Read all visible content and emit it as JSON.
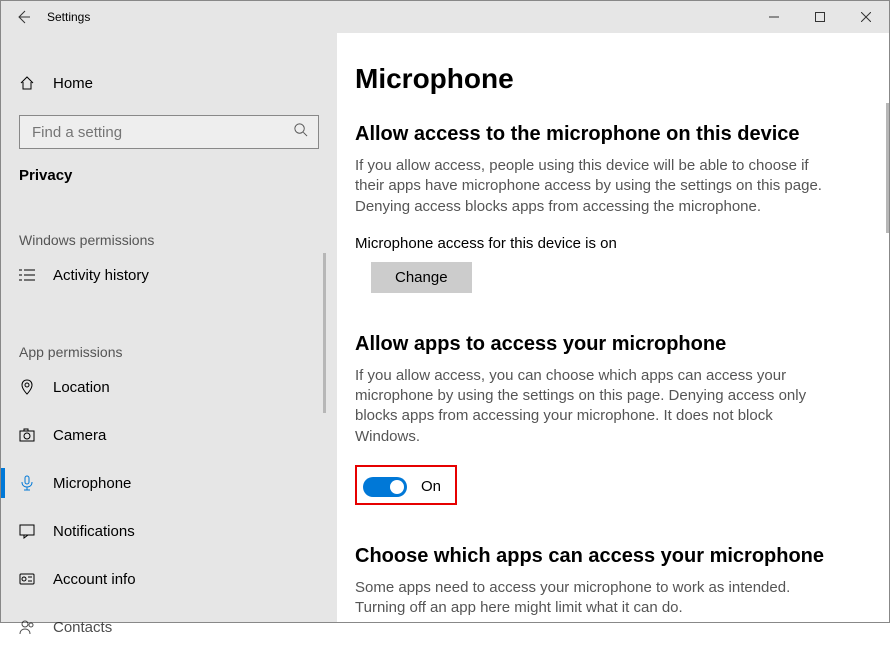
{
  "window": {
    "title": "Settings"
  },
  "sidebar": {
    "home": "Home",
    "search_placeholder": "Find a setting",
    "category": "Privacy",
    "section_win": "Windows permissions",
    "section_app": "App permissions",
    "items": {
      "activity": "Activity history",
      "location": "Location",
      "camera": "Camera",
      "microphone": "Microphone",
      "notifications": "Notifications",
      "account": "Account info",
      "contacts": "Contacts"
    }
  },
  "main": {
    "title": "Microphone",
    "s1": {
      "heading": "Allow access to the microphone on this device",
      "body": "If you allow access, people using this device will be able to choose if their apps have microphone access by using the settings on this page. Denying access blocks apps from accessing the microphone.",
      "status": "Microphone access for this device is on",
      "button": "Change"
    },
    "s2": {
      "heading": "Allow apps to access your microphone",
      "body": "If you allow access, you can choose which apps can access your microphone by using the settings on this page. Denying access only blocks apps from accessing your microphone. It does not block Windows.",
      "toggle": "On"
    },
    "s3": {
      "heading": "Choose which apps can access your microphone",
      "body": "Some apps need to access your microphone to work as intended. Turning off an app here might limit what it can do."
    }
  }
}
